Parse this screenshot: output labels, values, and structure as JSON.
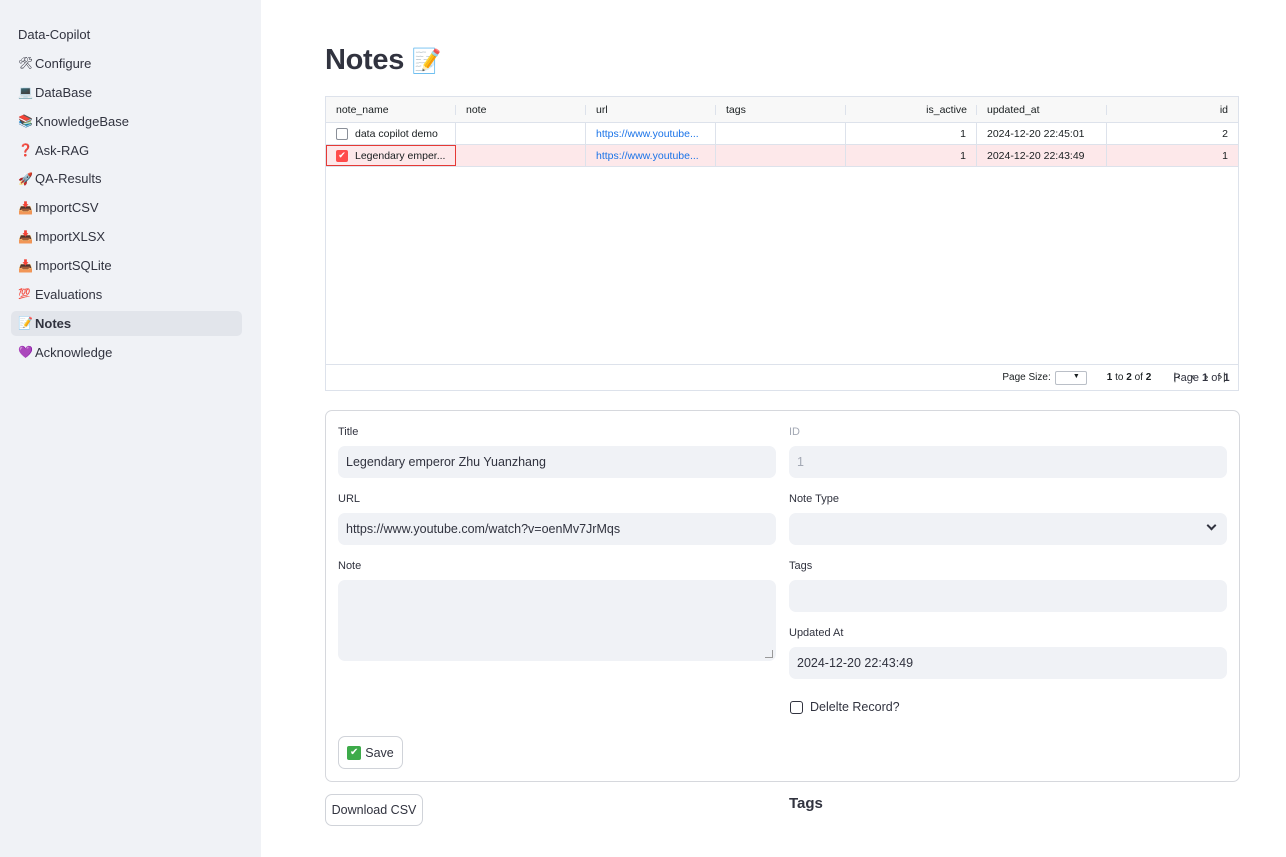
{
  "sidebar": {
    "app_title": "Data-Copilot",
    "items": [
      {
        "icon": "🛠",
        "label": "Configure"
      },
      {
        "icon": "💻",
        "label": "DataBase"
      },
      {
        "icon": "📚",
        "label": "KnowledgeBase"
      },
      {
        "icon": "❓",
        "label": "Ask-RAG"
      },
      {
        "icon": "🚀",
        "label": "QA-Results"
      },
      {
        "icon": "📥",
        "label": "ImportCSV"
      },
      {
        "icon": "📥",
        "label": "ImportXLSX"
      },
      {
        "icon": "📥",
        "label": "ImportSQLite"
      },
      {
        "icon": "💯",
        "label": "Evaluations"
      },
      {
        "icon": "📝",
        "label": "Notes",
        "active": true
      },
      {
        "icon": "💜",
        "label": "Acknowledge"
      }
    ]
  },
  "page": {
    "title": "Notes",
    "title_icon": "📝"
  },
  "grid": {
    "columns": [
      "note_name",
      "note",
      "url",
      "tags",
      "is_active",
      "updated_at",
      "id"
    ],
    "rows": [
      {
        "note_name": "data copilot demo",
        "note": "",
        "url": "https://www.youtube...",
        "tags": "",
        "is_active": "1",
        "updated_at": "2024-12-20 22:45:01",
        "id": "2",
        "selected": false
      },
      {
        "note_name": "Legendary emper...",
        "note": "",
        "url": "https://www.youtube...",
        "tags": "",
        "is_active": "1",
        "updated_at": "2024-12-20 22:43:49",
        "id": "1",
        "selected": true
      }
    ],
    "footer": {
      "page_size_label": "Page Size:",
      "range_from": "1",
      "range_to_label": "to",
      "range_to": "2",
      "of_label": "of",
      "total": "2",
      "page_label": "Page",
      "page_current": "1",
      "page_of_label": "of",
      "page_total": "1"
    }
  },
  "form": {
    "title_label": "Title",
    "title_value": "Legendary emperor Zhu Yuanzhang",
    "id_label": "ID",
    "id_value": "1",
    "url_label": "URL",
    "url_value": "https://www.youtube.com/watch?v=oenMv7JrMqs",
    "note_type_label": "Note Type",
    "note_type_value": "",
    "note_label": "Note",
    "note_value": "",
    "tags_label": "Tags",
    "tags_value": "",
    "updated_at_label": "Updated At",
    "updated_at_value": "2024-12-20 22:43:49",
    "delete_label": "Delelte Record?",
    "save_label": "Save",
    "save_icon": "✔"
  },
  "bottom": {
    "download_label": "Download CSV",
    "tags_heading": "Tags"
  },
  "colors": {
    "accent": "#ff4b4b",
    "link": "#1a73e8",
    "sidebar_bg": "#f0f2f6"
  }
}
